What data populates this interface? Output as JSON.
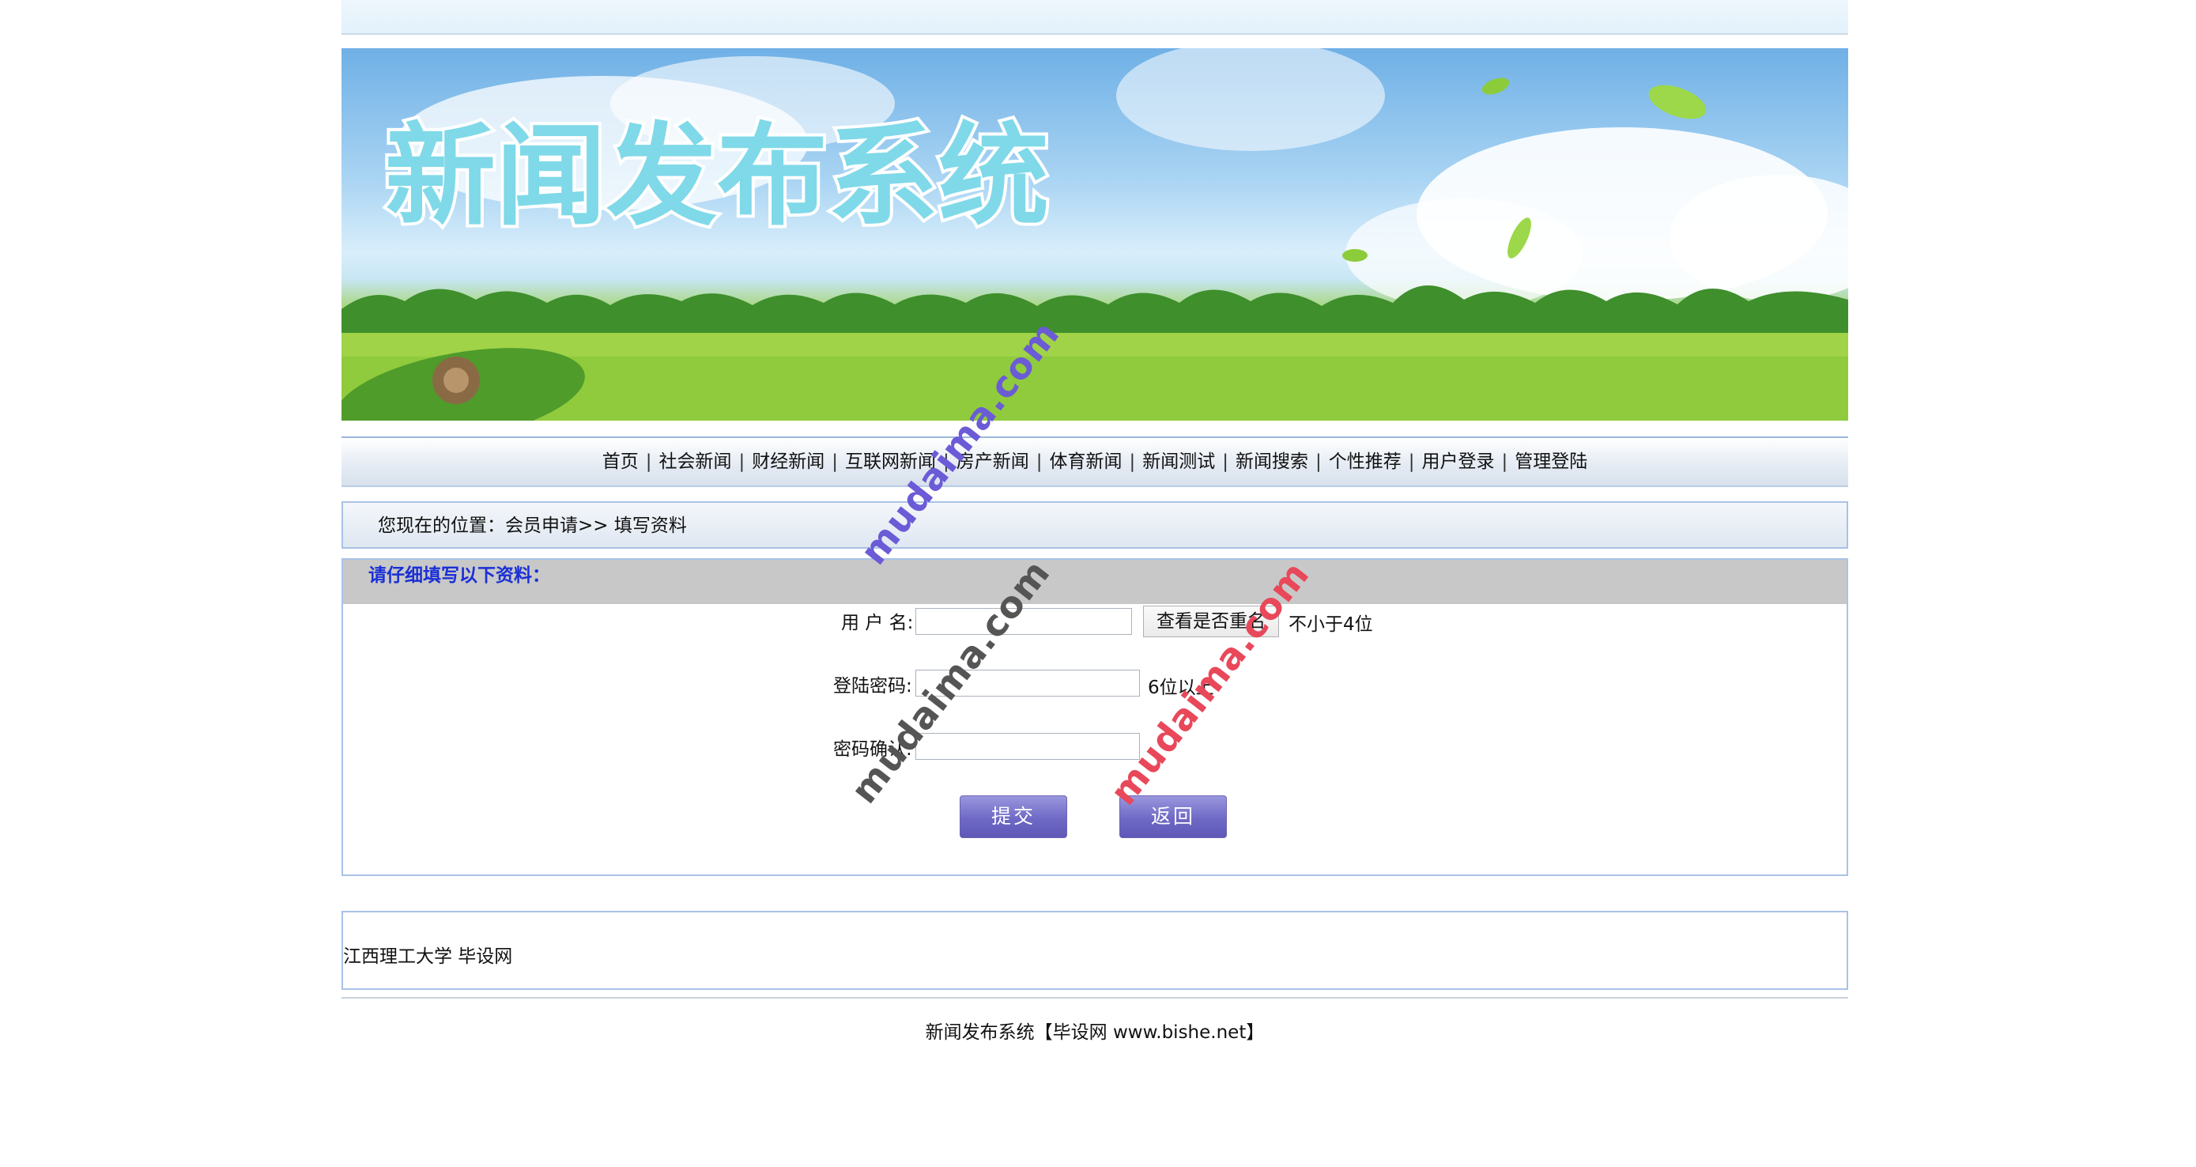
{
  "site_title": "新闻发布系统",
  "nav": {
    "items": [
      "首页",
      "社会新闻",
      "财经新闻",
      "互联网新闻",
      "房产新闻",
      "体育新闻",
      "新闻测试",
      "新闻搜索",
      "个性推荐",
      "用户登录",
      "管理登陆"
    ]
  },
  "breadcrumb": "您现在的位置：会员申请>> 填写资料",
  "form": {
    "header": "请仔细填写以下资料：",
    "username_label": "用 户 名:",
    "username_value": "",
    "check_button": "查看是否重名",
    "username_hint": "不小于4位",
    "password_label": "登陆密码:",
    "password_value": "",
    "password_hint": "6位以上",
    "confirm_label": "密码确认:",
    "confirm_value": "",
    "submit_label": "提交",
    "back_label": "返回"
  },
  "footer": {
    "org": "江西理工大学 毕设网",
    "copyright": "新闻发布系统【毕设网 www.bishe.net】"
  },
  "watermarks": [
    "mudaima.com",
    "mudaima.com",
    "mudaima.com"
  ],
  "colors": {
    "accent_blue": "#1a2fd6",
    "button_purple": "#6f69c6",
    "border_blue": "#a9c2e6",
    "watermark_purple": "#6b5bd6",
    "watermark_gray": "#555555",
    "watermark_red": "#e8485a"
  }
}
